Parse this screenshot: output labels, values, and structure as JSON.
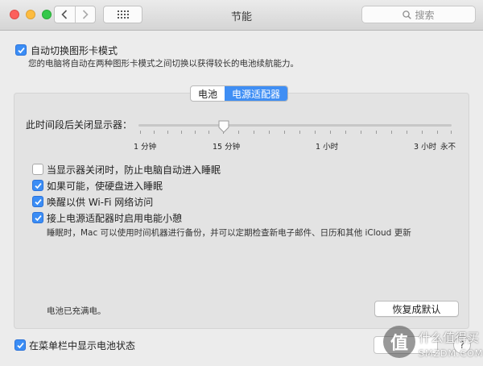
{
  "window": {
    "title": "节能"
  },
  "toolbar": {
    "search_placeholder": "搜索"
  },
  "auto_switch": {
    "label": "自动切换图形卡模式",
    "description": "您的电脑将自动在两种图形卡模式之间切换以获得较长的电池续航能力。",
    "checked": true
  },
  "tabs": [
    {
      "label": "电池",
      "active": false
    },
    {
      "label": "电源适配器",
      "active": true
    }
  ],
  "display_sleep": {
    "label": "此时间段后关闭显示器：",
    "ticks": [
      "1 分钟",
      "15 分钟",
      "1 小时",
      "3 小时",
      "永不"
    ],
    "value": "15 分钟"
  },
  "options": [
    {
      "label": "当显示器关闭时，防止电脑自动进入睡眠",
      "checked": false
    },
    {
      "label": "如果可能，使硬盘进入睡眠",
      "checked": true
    },
    {
      "label": "唤醒以供 Wi-Fi 网络访问",
      "checked": true
    },
    {
      "label": "接上电源适配器时启用电能小憩",
      "checked": true
    }
  ],
  "power_nap_description": "睡眠时，Mac 可以使用时间机器进行备份，并可以定期检查新电子邮件、日历和其他 iCloud 更新",
  "battery_status": "电池已充满电。",
  "restore_button": "恢复成默认",
  "menubar_option": {
    "label": "在菜单栏中显示电池状态",
    "checked": true
  },
  "help_label": "?",
  "watermark": {
    "line1": "什么值得买",
    "line2": "SMZDM.COM",
    "mark": "值"
  },
  "colors": {
    "accent": "#3b8df5",
    "segment_active": "#3f8ef4"
  }
}
